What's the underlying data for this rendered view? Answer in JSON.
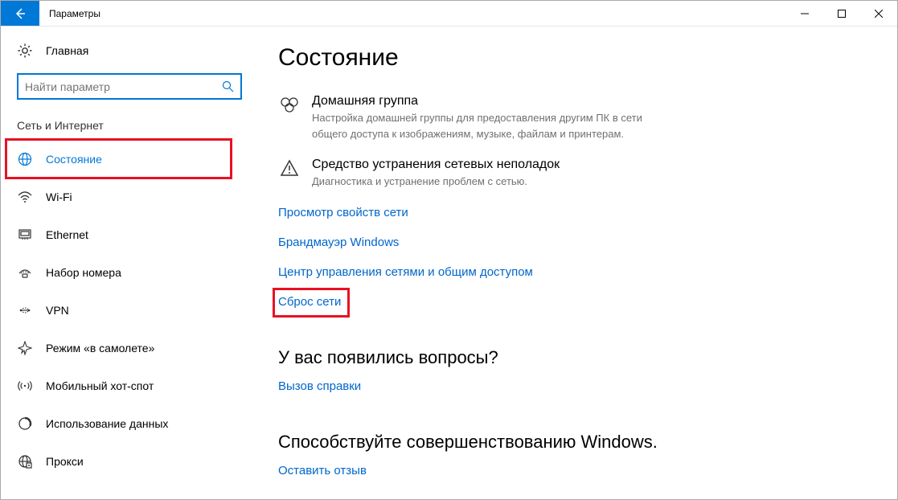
{
  "titlebar": {
    "title": "Параметры"
  },
  "sidebar": {
    "home": "Главная",
    "search_placeholder": "Найти параметр",
    "category": "Сеть и Интернет",
    "items": [
      {
        "label": "Состояние"
      },
      {
        "label": "Wi-Fi"
      },
      {
        "label": "Ethernet"
      },
      {
        "label": "Набор номера"
      },
      {
        "label": "VPN"
      },
      {
        "label": "Режим «в самолете»"
      },
      {
        "label": "Мобильный хот-спот"
      },
      {
        "label": "Использование данных"
      },
      {
        "label": "Прокси"
      }
    ]
  },
  "main": {
    "heading": "Состояние",
    "homegroup": {
      "title": "Домашняя группа",
      "sub": "Настройка домашней группы для предоставления другим ПК в сети общего доступа к изображениям, музыке, файлам и принтерам."
    },
    "troubleshoot": {
      "title": "Средство устранения сетевых неполадок",
      "sub": "Диагностика и устранение проблем с сетью."
    },
    "links": {
      "view_props": "Просмотр свойств сети",
      "firewall": "Брандмауэр Windows",
      "sharing_center": "Центр управления сетями и общим доступом",
      "network_reset": "Сброс сети"
    },
    "questions": {
      "heading": "У вас появились вопросы?",
      "link": "Вызов справки"
    },
    "feedback": {
      "heading": "Способствуйте совершенствованию Windows.",
      "link": "Оставить отзыв"
    }
  }
}
